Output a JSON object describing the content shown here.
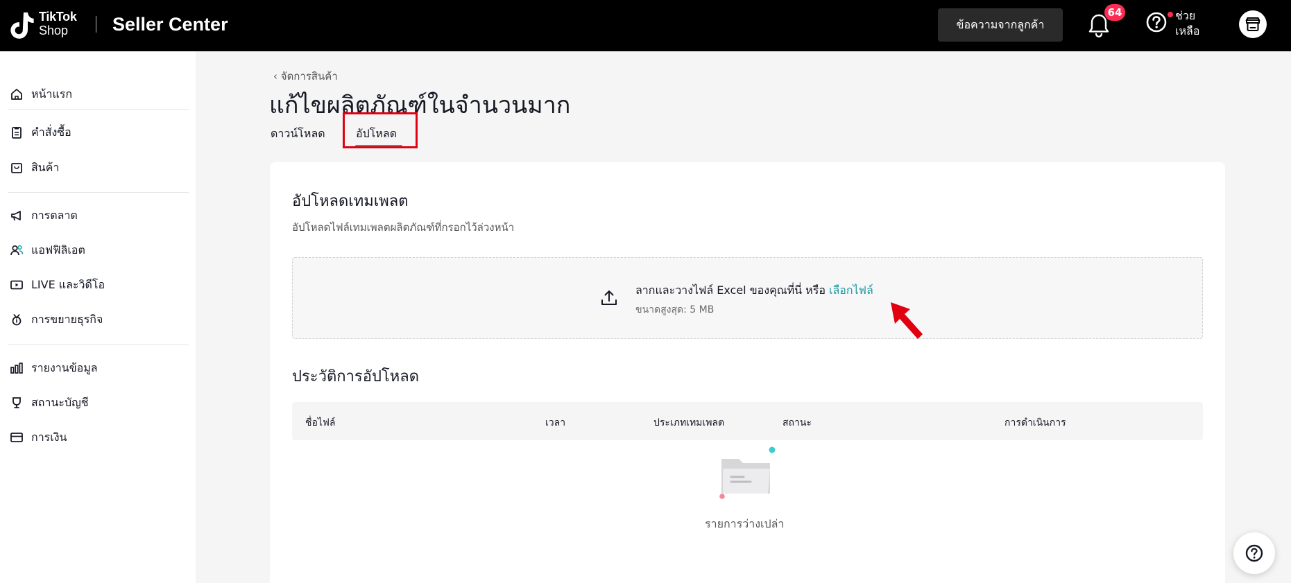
{
  "header": {
    "brand_top": "TikTok",
    "brand_bottom": "Shop",
    "title": "Seller Center",
    "customer_messages_label": "ข้อความจากลูกค้า",
    "notification_count": "64",
    "help_label": "ช่วยเหลือ",
    "accent_color": "#fe2c55"
  },
  "sidebar": {
    "items": [
      {
        "label": "หน้าแรก",
        "icon": "home-icon"
      },
      {
        "label": "คำสั่งซื้อ",
        "icon": "clipboard-icon"
      },
      {
        "label": "สินค้า",
        "icon": "product-box-icon"
      },
      {
        "label": "การตลาด",
        "icon": "megaphone-icon"
      },
      {
        "label": "แอฟฟิลิเอต",
        "icon": "people-icon"
      },
      {
        "label": "LIVE และวิดีโอ",
        "icon": "live-video-icon"
      },
      {
        "label": "การขยายธุรกิจ",
        "icon": "medal-icon"
      },
      {
        "label": "รายงานข้อมูล",
        "icon": "bar-chart-icon"
      },
      {
        "label": "สถานะบัญชี",
        "icon": "trophy-icon"
      },
      {
        "label": "การเงิน",
        "icon": "wallet-icon"
      }
    ]
  },
  "main": {
    "back_link": "จัดการสินค้า",
    "page_title": "แก้ไขผลิตภัณฑ์ในจำนวนมาก",
    "tabs": [
      {
        "label": "ดาวน์โหลด"
      },
      {
        "label": "อัปโหลด",
        "active": true
      }
    ],
    "upload_section": {
      "title": "อัปโหลดเทมเพลต",
      "description": "อัปโหลดไฟล์เทมเพลตผลิตภัณฑ์ที่กรอกไว้ล่วงหน้า",
      "drop_text": "ลากและวางไฟล์ Excel ของคุณที่นี่ หรือ ",
      "select_file_link": "เลือกไฟล์",
      "max_size": "ขนาดสูงสุด: 5 MB",
      "link_color": "#1a9aa0"
    },
    "history_section": {
      "title": "ประวัติการอัปโหลด",
      "columns": [
        "ชื่อไฟล์",
        "เวลา",
        "ประเภทเทมเพลต",
        "สถานะ",
        "การดำเนินการ"
      ],
      "rows": [],
      "empty_text": "รายการว่างเปล่า"
    }
  },
  "annotation_color": "#e0000f"
}
